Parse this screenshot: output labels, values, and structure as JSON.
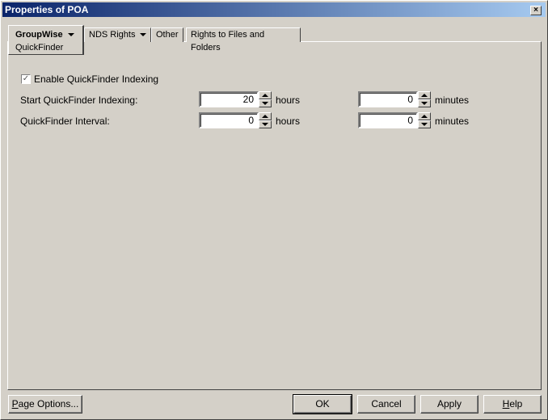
{
  "window": {
    "title": "Properties of POA",
    "close": "×"
  },
  "tabs": [
    {
      "label": "GroupWise",
      "sub": "QuickFinder"
    },
    {
      "label": "NDS Rights"
    },
    {
      "label": "Other"
    },
    {
      "label": "Rights to Files and Folders"
    }
  ],
  "form": {
    "enable_label": "Enable QuickFinder Indexing",
    "enable_checked": true,
    "check": "✓",
    "start_label": "Start QuickFinder Indexing:",
    "start_hours": "20",
    "start_minutes": "0",
    "interval_label": "QuickFinder Interval:",
    "interval_hours": "0",
    "interval_minutes": "0",
    "hours": "hours",
    "minutes": "minutes"
  },
  "buttons": {
    "page_options_u": "P",
    "page_options_rest": "age Options...",
    "ok": "OK",
    "cancel": "Cancel",
    "apply": "Apply",
    "help_u": "H",
    "help_rest": "elp"
  }
}
